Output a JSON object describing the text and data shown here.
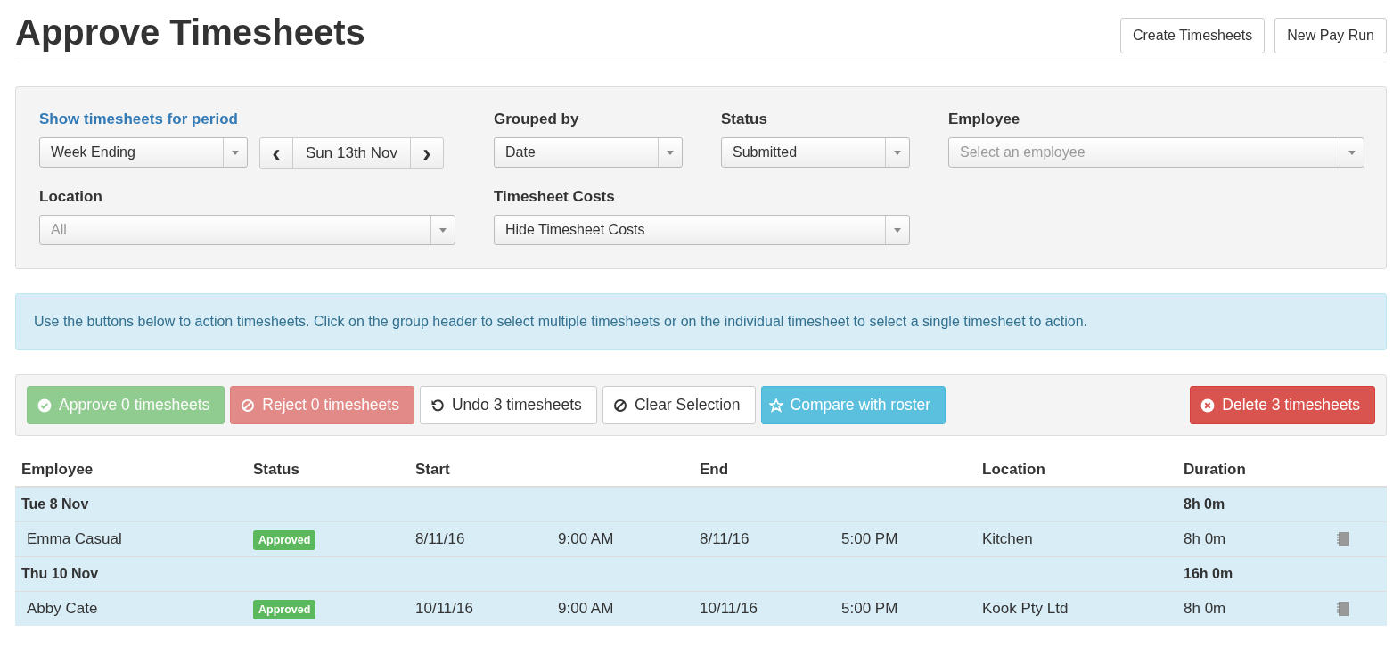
{
  "page": {
    "title": "Approve Timesheets",
    "header_buttons": [
      "Create Timesheets",
      "New Pay Run"
    ]
  },
  "filters": {
    "period": {
      "label": "Show timesheets for period",
      "value": "Week Ending",
      "date": "Sun 13th Nov",
      "prev": "‹",
      "next": "›"
    },
    "grouped_by": {
      "label": "Grouped by",
      "value": "Date"
    },
    "status": {
      "label": "Status",
      "value": "Submitted"
    },
    "employee": {
      "label": "Employee",
      "placeholder": "Select an employee"
    },
    "location": {
      "label": "Location",
      "placeholder": "All"
    },
    "costs": {
      "label": "Timesheet Costs",
      "value": "Hide Timesheet Costs"
    }
  },
  "info": "Use the buttons below to action timesheets. Click on the group header to select multiple timesheets or on the individual timesheet to select a single timesheet to action.",
  "actions": [
    {
      "kind": "approve",
      "label": "Approve 0 timesheets",
      "disabled": true
    },
    {
      "kind": "reject",
      "label": "Reject 0 timesheets",
      "disabled": true
    },
    {
      "kind": "undo",
      "label": "Undo 3 timesheets",
      "disabled": false
    },
    {
      "kind": "clear",
      "label": "Clear Selection",
      "disabled": false
    },
    {
      "kind": "compare",
      "label": "Compare with roster",
      "disabled": false
    },
    {
      "kind": "delete",
      "label": "Delete 3 timesheets",
      "disabled": false
    }
  ],
  "table": {
    "columns": [
      "Employee",
      "Status",
      "Start",
      "End",
      "Location",
      "Duration"
    ],
    "groups": [
      {
        "label": "Tue 8 Nov",
        "duration": "8h 0m",
        "rows": [
          {
            "employee": "Emma Casual",
            "status": "Approved",
            "start_date": "8/11/16",
            "start_time": "9:00 AM",
            "end_date": "8/11/16",
            "end_time": "5:00 PM",
            "location": "Kitchen",
            "duration": "8h 0m"
          }
        ]
      },
      {
        "label": "Thu 10 Nov",
        "duration": "16h 0m",
        "rows": [
          {
            "employee": "Abby Cate",
            "status": "Approved",
            "start_date": "10/11/16",
            "start_time": "9:00 AM",
            "end_date": "10/11/16",
            "end_time": "5:00 PM",
            "location": "Kook Pty Ltd",
            "duration": "8h 0m"
          }
        ]
      }
    ]
  }
}
